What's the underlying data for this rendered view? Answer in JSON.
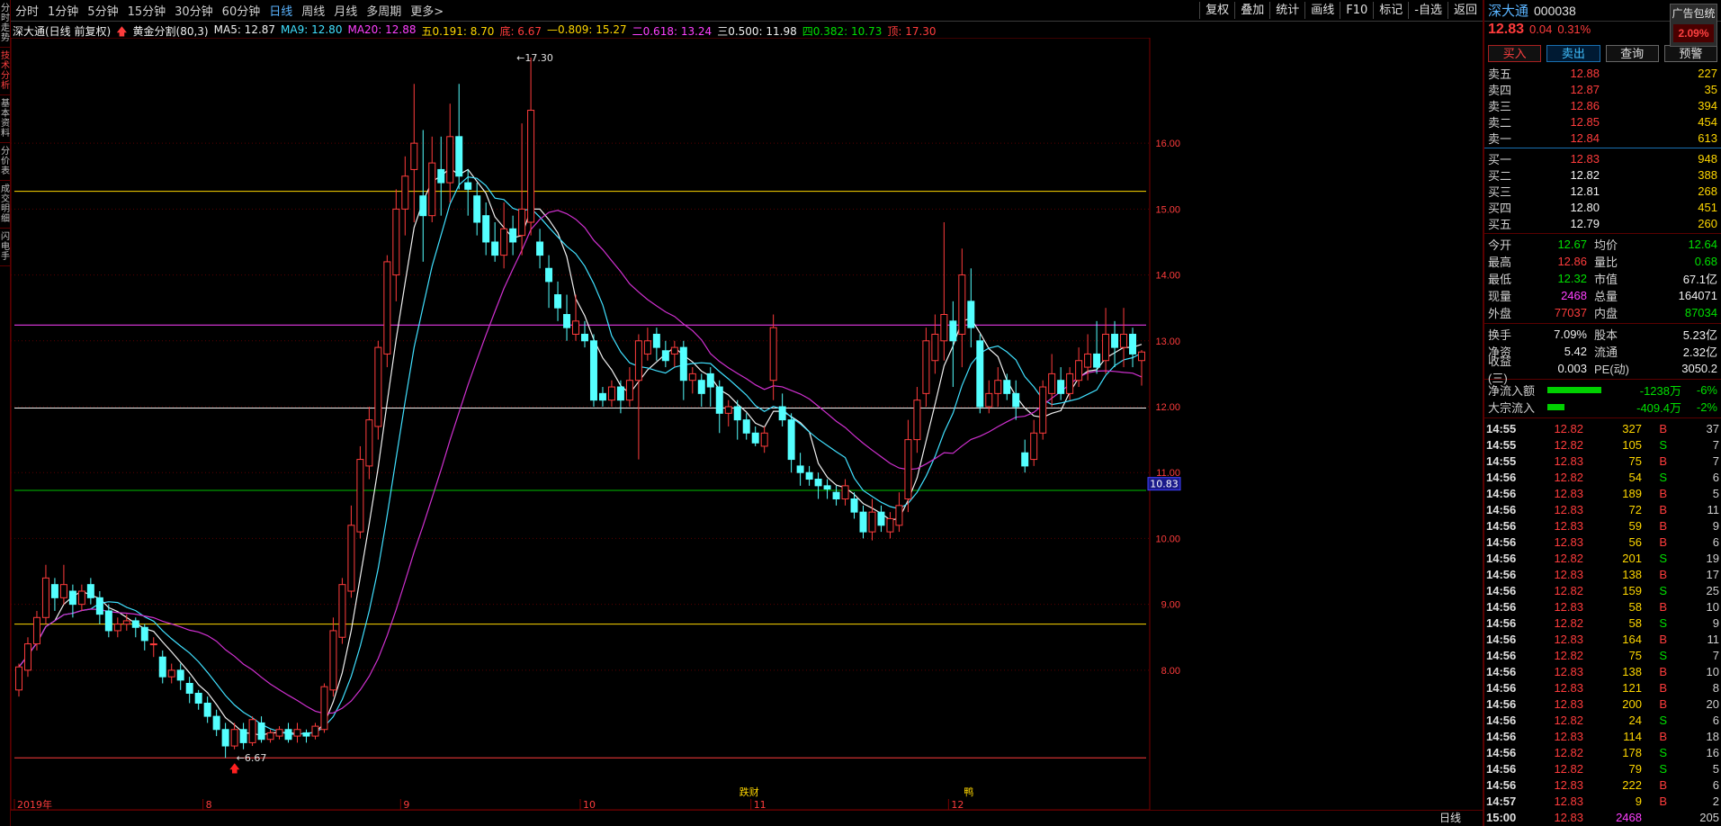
{
  "periods": [
    "分时",
    "1分钟",
    "5分钟",
    "15分钟",
    "30分钟",
    "60分钟",
    "日线",
    "周线",
    "月线",
    "多周期",
    "更多>"
  ],
  "active_period": "日线",
  "toolbar_right": [
    "复权",
    "叠加",
    "统计",
    "画线",
    "F10",
    "标记",
    "-自选",
    "返回"
  ],
  "left_tabs": [
    "分时走势",
    "技术分析",
    "基本资料",
    "分价表",
    "成交明细",
    "闪电手"
  ],
  "chart_info": {
    "title": "深大通(日线 前复权)",
    "indicator": "黄金分割(80,3)",
    "ma5": "MA5: 12.87",
    "ma9": "MA9: 12.80",
    "ma20": "MA20: 12.88",
    "fib_items": [
      {
        "text": "五0.191: 8.70",
        "color": "#ffd700"
      },
      {
        "text": "底: 6.67",
        "color": "#ff3c3c"
      },
      {
        "text": "—0.809: 15.27",
        "color": "#ffd700"
      },
      {
        "text": "二0.618: 13.24",
        "color": "#ff40ff"
      },
      {
        "text": "三0.500: 11.98",
        "color": "#f0f0f0"
      },
      {
        "text": "四0.382: 10.73",
        "color": "#00e000"
      },
      {
        "text": "顶: 17.30",
        "color": "#ff3c3c"
      }
    ]
  },
  "chart_data": {
    "type": "candlestick",
    "yaxis_ticks": [
      8.0,
      9.0,
      10.0,
      11.0,
      12.0,
      13.0,
      14.0,
      15.0,
      16.0
    ],
    "ylim": [
      6.4,
      17.6
    ],
    "x_month_labels": [
      {
        "label": "2019年",
        "index": 0
      },
      {
        "label": "8",
        "index": 21
      },
      {
        "label": "9",
        "index": 43
      },
      {
        "label": "10",
        "index": 63
      },
      {
        "label": "11",
        "index": 82
      },
      {
        "label": "12",
        "index": 104
      }
    ],
    "fib_lines": [
      {
        "value": 15.27,
        "color": "#ffd700"
      },
      {
        "value": 13.24,
        "color": "#ff40ff"
      },
      {
        "value": 11.98,
        "color": "#f0f0f0"
      },
      {
        "value": 10.73,
        "color": "#00c000"
      },
      {
        "value": 8.7,
        "color": "#ffd700"
      },
      {
        "value": 6.67,
        "color": "#ff3c3c"
      }
    ],
    "high_marker": {
      "label": "17.30",
      "index": 55
    },
    "low_marker": {
      "label": "6.67",
      "index": 24
    },
    "current_price_tag": "10.83",
    "event_tags": [
      {
        "label": "跌财",
        "index": 81
      },
      {
        "label": "鸭",
        "index": 106
      }
    ],
    "period_label": "日线",
    "candles": [
      [
        7.7,
        8.05,
        7.6,
        8.1
      ],
      [
        8.0,
        8.4,
        7.9,
        8.5
      ],
      [
        8.4,
        8.8,
        8.3,
        8.9
      ],
      [
        8.8,
        9.4,
        8.7,
        9.6
      ],
      [
        9.3,
        9.1,
        8.9,
        9.4
      ],
      [
        9.1,
        9.3,
        9.0,
        9.6
      ],
      [
        9.2,
        9.0,
        8.8,
        9.3
      ],
      [
        9.0,
        9.2,
        8.9,
        9.3
      ],
      [
        9.3,
        9.1,
        9.0,
        9.4
      ],
      [
        9.1,
        8.85,
        8.7,
        9.2
      ],
      [
        8.9,
        8.6,
        8.5,
        9.0
      ],
      [
        8.6,
        8.7,
        8.5,
        8.8
      ],
      [
        8.7,
        8.75,
        8.6,
        8.85
      ],
      [
        8.75,
        8.65,
        8.5,
        8.8
      ],
      [
        8.65,
        8.45,
        8.3,
        8.7
      ],
      [
        8.4,
        8.4,
        8.2,
        8.5
      ],
      [
        8.2,
        7.9,
        7.8,
        8.3
      ],
      [
        7.9,
        8.0,
        7.8,
        8.1
      ],
      [
        8.0,
        7.85,
        7.7,
        8.1
      ],
      [
        7.8,
        7.65,
        7.5,
        7.9
      ],
      [
        7.65,
        7.5,
        7.4,
        7.7
      ],
      [
        7.5,
        7.3,
        7.2,
        7.6
      ],
      [
        7.3,
        7.1,
        7.0,
        7.4
      ],
      [
        7.1,
        6.85,
        6.67,
        7.2
      ],
      [
        6.85,
        7.1,
        6.8,
        7.2
      ],
      [
        7.1,
        6.9,
        6.8,
        7.2
      ],
      [
        6.9,
        7.25,
        6.85,
        7.3
      ],
      [
        7.2,
        6.95,
        6.9,
        7.3
      ],
      [
        6.95,
        7.05,
        6.9,
        7.1
      ],
      [
        7.0,
        7.1,
        6.95,
        7.15
      ],
      [
        7.1,
        6.95,
        6.9,
        7.2
      ],
      [
        7.0,
        7.1,
        6.9,
        7.2
      ],
      [
        7.05,
        7.0,
        6.9,
        7.1
      ],
      [
        7.0,
        7.15,
        6.95,
        7.2
      ],
      [
        7.1,
        7.75,
        7.05,
        7.8
      ],
      [
        7.7,
        8.6,
        7.6,
        8.8
      ],
      [
        8.5,
        9.3,
        8.4,
        9.4
      ],
      [
        9.2,
        10.2,
        9.1,
        10.5
      ],
      [
        10.1,
        11.2,
        10.0,
        11.4
      ],
      [
        11.1,
        11.8,
        10.9,
        12.0
      ],
      [
        11.7,
        12.9,
        11.5,
        13.0
      ],
      [
        12.8,
        14.2,
        12.6,
        14.3
      ],
      [
        14.0,
        15.0,
        13.6,
        15.3
      ],
      [
        15.0,
        15.5,
        14.6,
        15.8
      ],
      [
        15.6,
        16.0,
        14.8,
        16.9
      ],
      [
        15.2,
        14.9,
        14.2,
        16.2
      ],
      [
        14.9,
        15.7,
        14.8,
        16.1
      ],
      [
        15.6,
        15.4,
        14.9,
        16.1
      ],
      [
        15.4,
        16.1,
        15.1,
        16.6
      ],
      [
        16.1,
        15.5,
        15.3,
        16.9
      ],
      [
        15.4,
        15.3,
        14.9,
        15.6
      ],
      [
        15.2,
        14.8,
        14.6,
        15.4
      ],
      [
        14.9,
        14.5,
        14.3,
        15.1
      ],
      [
        14.5,
        14.3,
        14.2,
        14.8
      ],
      [
        14.3,
        14.7,
        14.1,
        15.1
      ],
      [
        14.7,
        14.5,
        14.3,
        14.9
      ],
      [
        14.6,
        15.0,
        14.3,
        16.3
      ],
      [
        14.8,
        16.5,
        14.6,
        17.3
      ],
      [
        14.5,
        14.3,
        14.1,
        14.7
      ],
      [
        14.1,
        13.9,
        13.5,
        14.3
      ],
      [
        13.7,
        13.5,
        13.3,
        13.9
      ],
      [
        13.4,
        13.2,
        13.0,
        13.7
      ],
      [
        13.1,
        13.3,
        13.0,
        13.7
      ],
      [
        13.1,
        13.0,
        12.9,
        13.3
      ],
      [
        13.0,
        12.1,
        12.0,
        13.1
      ],
      [
        12.2,
        12.1,
        12.0,
        12.3
      ],
      [
        12.1,
        12.3,
        12.0,
        12.4
      ],
      [
        12.3,
        12.1,
        11.9,
        12.4
      ],
      [
        12.1,
        12.4,
        12.0,
        12.6
      ],
      [
        12.4,
        13.0,
        11.2,
        13.1
      ],
      [
        12.8,
        13.0,
        12.7,
        13.2
      ],
      [
        13.1,
        12.9,
        12.7,
        13.2
      ],
      [
        12.85,
        12.7,
        12.6,
        13.0
      ],
      [
        12.8,
        12.9,
        12.6,
        13.0
      ],
      [
        12.9,
        12.4,
        12.1,
        13.0
      ],
      [
        12.4,
        12.5,
        12.2,
        12.6
      ],
      [
        12.4,
        12.2,
        12.0,
        12.5
      ],
      [
        12.5,
        12.3,
        12.0,
        12.6
      ],
      [
        12.3,
        11.9,
        11.6,
        12.4
      ],
      [
        11.9,
        12.0,
        11.7,
        12.1
      ],
      [
        12.0,
        11.8,
        11.5,
        12.1
      ],
      [
        11.8,
        11.6,
        11.5,
        11.9
      ],
      [
        11.6,
        11.45,
        11.4,
        11.7
      ],
      [
        11.4,
        11.6,
        11.3,
        11.7
      ],
      [
        12.4,
        13.2,
        12.1,
        13.4
      ],
      [
        12.0,
        11.8,
        11.7,
        12.2
      ],
      [
        11.8,
        11.2,
        11.0,
        11.9
      ],
      [
        11.1,
        11.0,
        10.8,
        11.3
      ],
      [
        11.0,
        10.9,
        10.8,
        11.1
      ],
      [
        10.9,
        10.8,
        10.6,
        11.0
      ],
      [
        10.8,
        10.75,
        10.6,
        10.9
      ],
      [
        10.7,
        10.6,
        10.5,
        10.8
      ],
      [
        10.6,
        10.8,
        10.5,
        10.9
      ],
      [
        10.6,
        10.4,
        10.3,
        10.7
      ],
      [
        10.4,
        10.1,
        10.0,
        10.5
      ],
      [
        10.1,
        10.4,
        9.97,
        10.6
      ],
      [
        10.4,
        10.2,
        10.1,
        10.5
      ],
      [
        10.1,
        10.3,
        10.0,
        10.4
      ],
      [
        10.2,
        10.5,
        10.1,
        10.7
      ],
      [
        10.6,
        11.5,
        10.4,
        11.8
      ],
      [
        11.5,
        12.1,
        11.3,
        12.3
      ],
      [
        12.2,
        13.0,
        12.0,
        13.2
      ],
      [
        12.7,
        13.1,
        12.5,
        13.4
      ],
      [
        13.0,
        13.4,
        12.7,
        14.8
      ],
      [
        13.3,
        13.0,
        12.3,
        13.6
      ],
      [
        13.1,
        14.0,
        12.6,
        14.4
      ],
      [
        13.6,
        13.2,
        12.9,
        14.1
      ],
      [
        13.0,
        12.0,
        11.9,
        13.1
      ],
      [
        12.0,
        12.2,
        11.9,
        12.4
      ],
      [
        12.2,
        12.4,
        12.0,
        12.6
      ],
      [
        12.4,
        12.2,
        12.1,
        12.5
      ],
      [
        12.2,
        12.0,
        11.8,
        12.4
      ],
      [
        11.3,
        11.1,
        11.0,
        11.5
      ],
      [
        11.2,
        11.6,
        11.1,
        11.8
      ],
      [
        11.6,
        12.3,
        11.5,
        12.4
      ],
      [
        12.2,
        12.5,
        12.0,
        12.8
      ],
      [
        12.4,
        12.2,
        12.1,
        12.6
      ],
      [
        12.2,
        12.5,
        12.1,
        12.6
      ],
      [
        12.4,
        12.7,
        12.3,
        12.9
      ],
      [
        12.6,
        12.8,
        12.4,
        13.1
      ],
      [
        12.8,
        12.6,
        12.5,
        13.3
      ],
      [
        12.7,
        13.1,
        12.5,
        13.5
      ],
      [
        13.1,
        12.9,
        12.6,
        13.3
      ],
      [
        12.9,
        13.1,
        12.6,
        13.5
      ],
      [
        13.1,
        12.8,
        12.6,
        13.2
      ],
      [
        12.7,
        12.83,
        12.32,
        12.86
      ]
    ],
    "ma_series": [
      {
        "name": "MA5",
        "color": "#f0f0f0",
        "period": 5
      },
      {
        "name": "MA9",
        "color": "#40e0ff",
        "period": 9
      },
      {
        "name": "MA20",
        "color": "#d030d0",
        "period": 20
      }
    ]
  },
  "quote": {
    "name": "深大通",
    "code": "000038",
    "ad_label": "广告包统",
    "ad_pct": "2.09%",
    "price": "12.83",
    "change": "0.04",
    "change_pct": "0.31%",
    "buttons": [
      "买入",
      "卖出",
      "查询",
      "预警"
    ],
    "asks": [
      {
        "label": "卖五",
        "price": "12.88",
        "qty": "227"
      },
      {
        "label": "卖四",
        "price": "12.87",
        "qty": "35"
      },
      {
        "label": "卖三",
        "price": "12.86",
        "qty": "394"
      },
      {
        "label": "卖二",
        "price": "12.85",
        "qty": "454"
      },
      {
        "label": "卖一",
        "price": "12.84",
        "qty": "613"
      }
    ],
    "bids": [
      {
        "label": "买一",
        "price": "12.83",
        "qty": "948"
      },
      {
        "label": "买二",
        "price": "12.82",
        "qty": "388"
      },
      {
        "label": "买三",
        "price": "12.81",
        "qty": "268"
      },
      {
        "label": "买四",
        "price": "12.80",
        "qty": "451"
      },
      {
        "label": "买五",
        "price": "12.79",
        "qty": "260"
      }
    ],
    "stats": [
      {
        "l1": "今开",
        "v1": "12.67",
        "c1": "green",
        "l2": "均价",
        "v2": "12.64",
        "c2": "green"
      },
      {
        "l1": "最高",
        "v1": "12.86",
        "c1": "red",
        "l2": "量比",
        "v2": "0.68",
        "c2": "green"
      },
      {
        "l1": "最低",
        "v1": "12.32",
        "c1": "green",
        "l2": "市值",
        "v2": "67.1亿",
        "c2": "white"
      },
      {
        "l1": "现量",
        "v1": "2468",
        "c1": "magenta",
        "l2": "总量",
        "v2": "164071",
        "c2": "white"
      },
      {
        "l1": "外盘",
        "v1": "77037",
        "c1": "red",
        "l2": "内盘",
        "v2": "87034",
        "c2": "green"
      }
    ],
    "stats2": [
      {
        "l1": "换手",
        "v1": "7.09%",
        "c1": "white",
        "l2": "股本",
        "v2": "5.23亿",
        "c2": "white"
      },
      {
        "l1": "净资",
        "v1": "5.42",
        "c1": "white",
        "l2": "流通",
        "v2": "2.32亿",
        "c2": "white"
      },
      {
        "l1": "收益(三)",
        "v1": "0.003",
        "c1": "white",
        "l2": "PE(动)",
        "v2": "3050.2",
        "c2": "white"
      }
    ],
    "flows": [
      {
        "label": "净流入额",
        "value": "-1238万",
        "pct": "-6%",
        "bar": 0.8
      },
      {
        "label": "大宗流入",
        "value": "-409.4万",
        "pct": "-2%",
        "bar": 0.25
      }
    ],
    "ticks": [
      {
        "t": "14:55",
        "p": "12.82",
        "v": "327",
        "bs": "B",
        "n": "37"
      },
      {
        "t": "14:55",
        "p": "12.82",
        "v": "105",
        "bs": "S",
        "n": "7"
      },
      {
        "t": "14:55",
        "p": "12.83",
        "v": "75",
        "bs": "B",
        "n": "7"
      },
      {
        "t": "14:56",
        "p": "12.82",
        "v": "54",
        "bs": "S",
        "n": "6"
      },
      {
        "t": "14:56",
        "p": "12.83",
        "v": "189",
        "bs": "B",
        "n": "5"
      },
      {
        "t": "14:56",
        "p": "12.83",
        "v": "72",
        "bs": "B",
        "n": "11"
      },
      {
        "t": "14:56",
        "p": "12.83",
        "v": "59",
        "bs": "B",
        "n": "9"
      },
      {
        "t": "14:56",
        "p": "12.83",
        "v": "56",
        "bs": "B",
        "n": "6"
      },
      {
        "t": "14:56",
        "p": "12.82",
        "v": "201",
        "bs": "S",
        "n": "19"
      },
      {
        "t": "14:56",
        "p": "12.83",
        "v": "138",
        "bs": "B",
        "n": "17"
      },
      {
        "t": "14:56",
        "p": "12.82",
        "v": "159",
        "bs": "S",
        "n": "25"
      },
      {
        "t": "14:56",
        "p": "12.83",
        "v": "58",
        "bs": "B",
        "n": "10"
      },
      {
        "t": "14:56",
        "p": "12.82",
        "v": "58",
        "bs": "S",
        "n": "9"
      },
      {
        "t": "14:56",
        "p": "12.83",
        "v": "164",
        "bs": "B",
        "n": "11"
      },
      {
        "t": "14:56",
        "p": "12.82",
        "v": "75",
        "bs": "S",
        "n": "7"
      },
      {
        "t": "14:56",
        "p": "12.83",
        "v": "138",
        "bs": "B",
        "n": "10"
      },
      {
        "t": "14:56",
        "p": "12.83",
        "v": "121",
        "bs": "B",
        "n": "8"
      },
      {
        "t": "14:56",
        "p": "12.83",
        "v": "200",
        "bs": "B",
        "n": "20"
      },
      {
        "t": "14:56",
        "p": "12.82",
        "v": "24",
        "bs": "S",
        "n": "6"
      },
      {
        "t": "14:56",
        "p": "12.83",
        "v": "114",
        "bs": "B",
        "n": "18"
      },
      {
        "t": "14:56",
        "p": "12.82",
        "v": "178",
        "bs": "S",
        "n": "16"
      },
      {
        "t": "14:56",
        "p": "12.82",
        "v": "79",
        "bs": "S",
        "n": "5"
      },
      {
        "t": "14:56",
        "p": "12.83",
        "v": "222",
        "bs": "B",
        "n": "6"
      },
      {
        "t": "14:57",
        "p": "12.83",
        "v": "9",
        "bs": "B",
        "n": "2"
      },
      {
        "t": "15:00",
        "p": "12.83",
        "v": "2468",
        "bs": "",
        "n": "205"
      }
    ]
  }
}
